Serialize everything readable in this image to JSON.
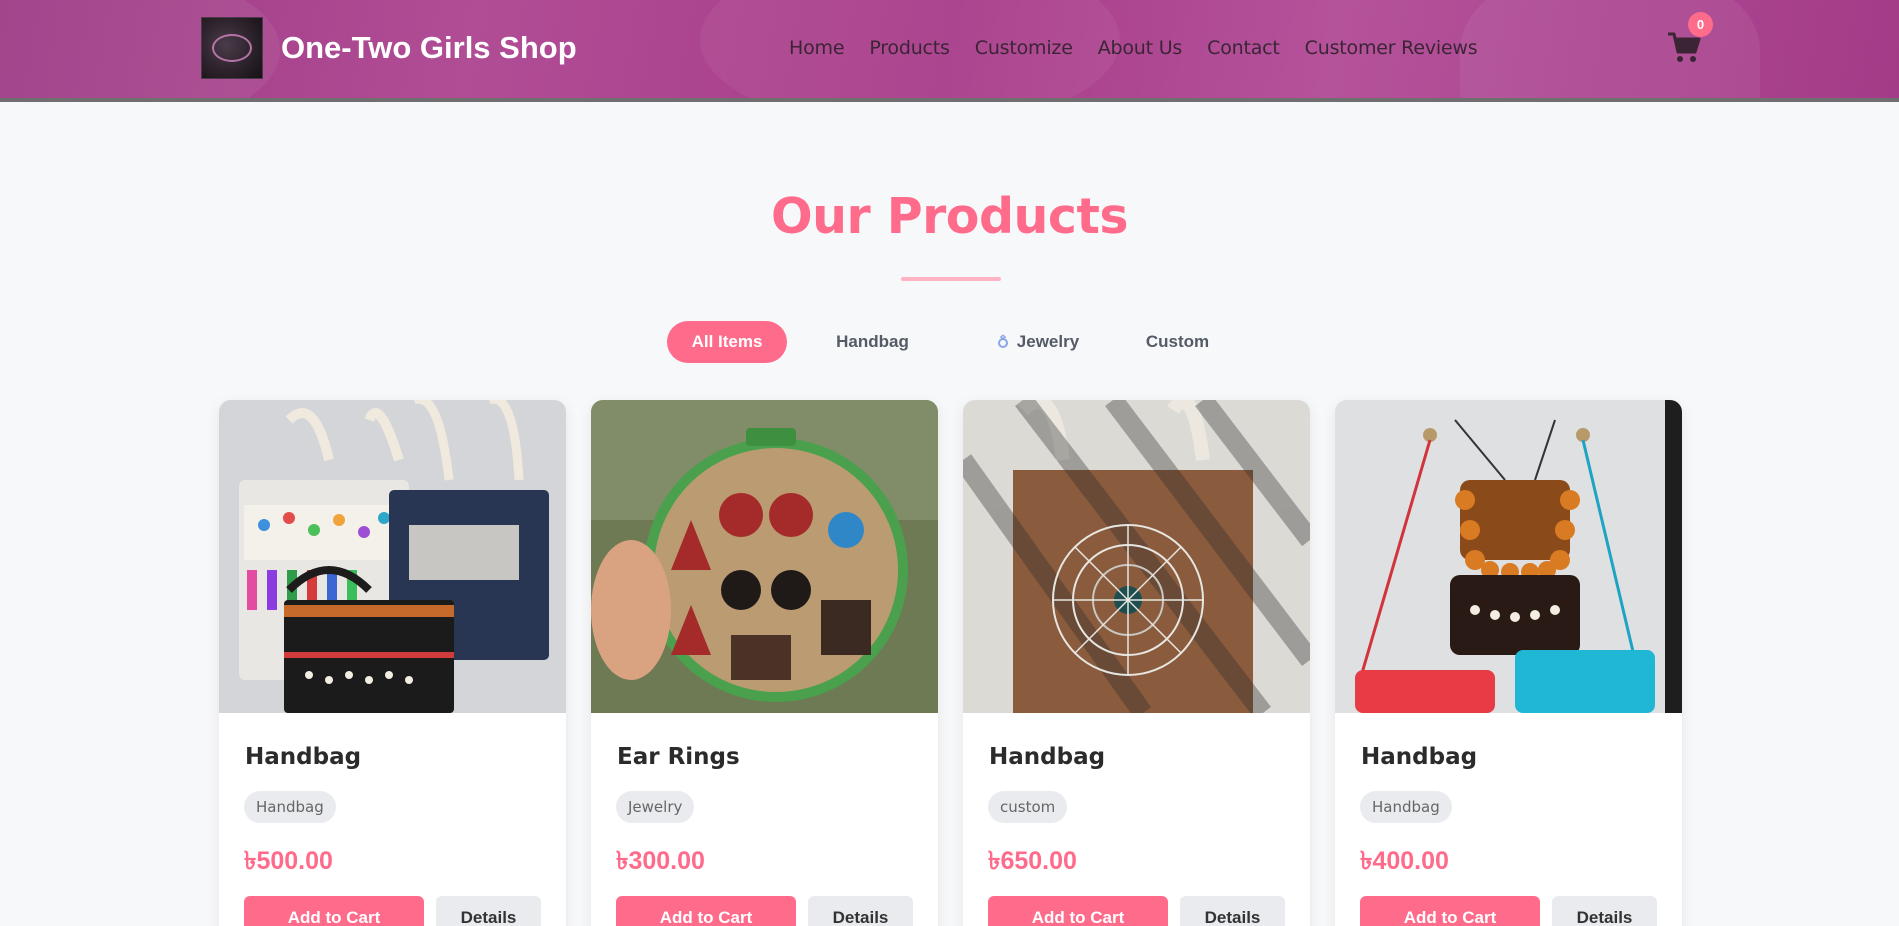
{
  "header": {
    "brand": "One-Two Girls Shop",
    "nav": [
      "Home",
      "Products",
      "Customize",
      "About Us",
      "Contact",
      "Customer Reviews"
    ],
    "cart_count": "0",
    "cart_icon": "shopping-cart-icon"
  },
  "section": {
    "title": "Our Products"
  },
  "filters": [
    {
      "label": "All Items",
      "active": true
    },
    {
      "label": "Handbag",
      "active": false
    },
    {
      "label": "Jewelry",
      "active": false,
      "icon": "ring-icon"
    },
    {
      "label": "Custom",
      "active": false
    }
  ],
  "products": [
    {
      "name": "Handbag",
      "tag": "Handbag",
      "price": "৳500.00",
      "add_label": "Add to Cart",
      "details_label": "Details",
      "image": "tote-bags-photo"
    },
    {
      "name": "Ear Rings",
      "tag": "Jewelry",
      "price": "৳300.00",
      "add_label": "Add to Cart",
      "details_label": "Details",
      "image": "earrings-hoop-photo"
    },
    {
      "name": "Handbag",
      "tag": "custom",
      "price": "৳650.00",
      "add_label": "Add to Cart",
      "details_label": "Details",
      "image": "brown-tote-photo"
    },
    {
      "name": "Handbag",
      "tag": "Handbag",
      "price": "৳400.00",
      "add_label": "Add to Cart",
      "details_label": "Details",
      "image": "hanging-bags-photo"
    }
  ],
  "colors": {
    "accent": "#ff6b8b",
    "header": "#a83c8a",
    "tag_bg": "#e9ebef"
  }
}
